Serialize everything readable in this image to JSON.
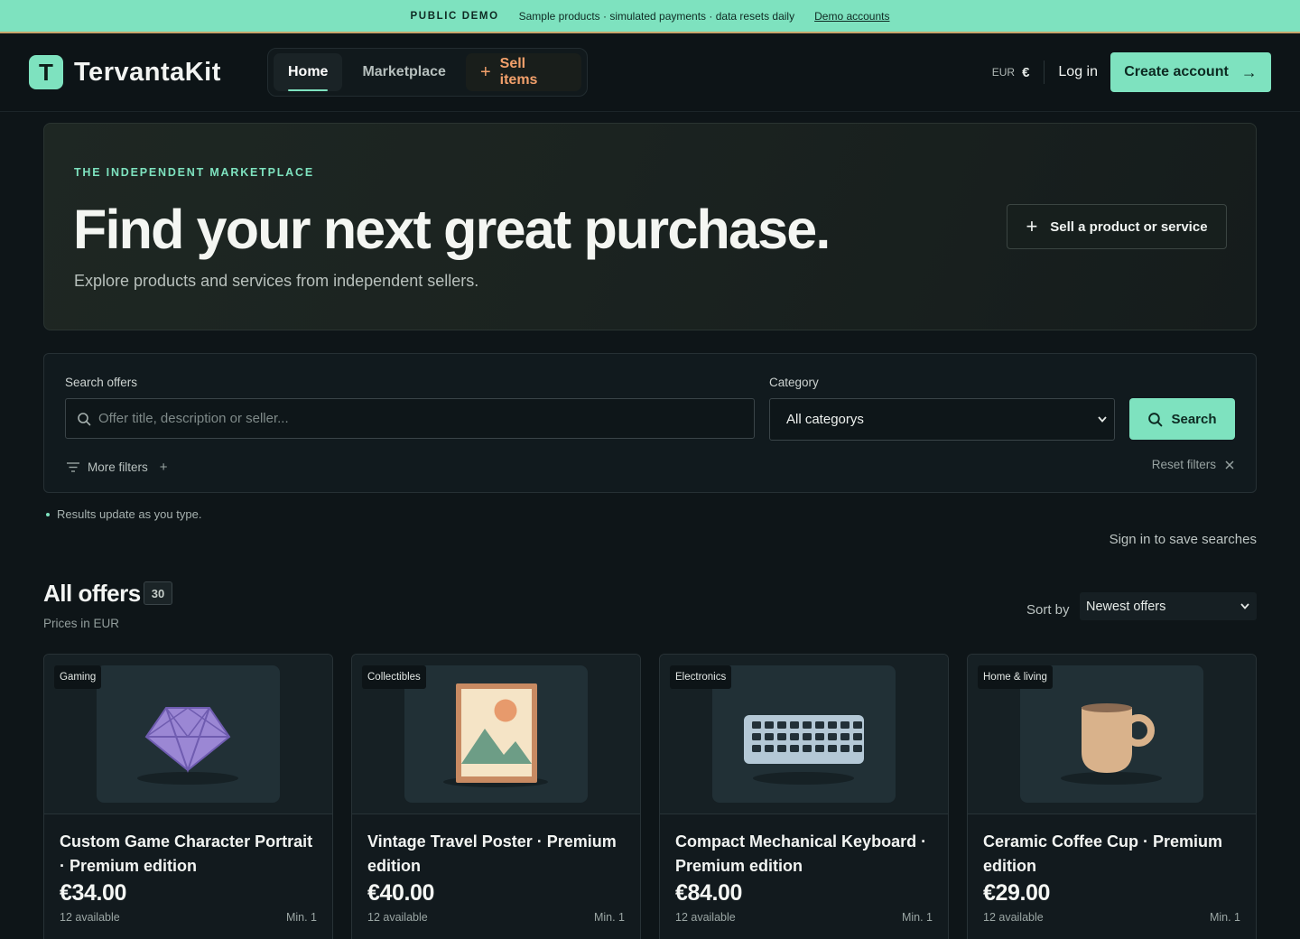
{
  "banner": {
    "tag": "PUBLIC DEMO",
    "text": "Sample products · simulated payments · data resets daily",
    "link": "Demo accounts"
  },
  "brand": {
    "mark": "T",
    "name": "TervantaKit",
    "accent": "#7ee2bf"
  },
  "nav": {
    "home": "Home",
    "marketplace": "Marketplace",
    "sell": "Sell items"
  },
  "header": {
    "currency_code": "EUR",
    "currency_symbol": "€",
    "login": "Log in",
    "create_account": "Create account"
  },
  "hero": {
    "eyebrow": "THE INDEPENDENT MARKETPLACE",
    "title": "Find your next great purchase.",
    "subtitle": "Explore products and services from independent sellers.",
    "sell_button": "Sell a product or service"
  },
  "search": {
    "label": "Search offers",
    "placeholder": "Offer title, description or seller...",
    "value": "",
    "category_label": "Category",
    "category_value": "All categorys",
    "button": "Search",
    "more_filters": "More filters",
    "reset_filters": "Reset filters"
  },
  "live_note": "Results update as you type.",
  "save_searches": "Sign in to save searches",
  "offers": {
    "title": "All offers",
    "count": "30",
    "prices_note": "Prices in EUR",
    "sort_label": "Sort by",
    "sort_value": "Newest offers"
  },
  "cards": [
    {
      "category": "Gaming",
      "title": "Custom Game Character Portrait · Premium edition",
      "price": "€34.00",
      "stock": "12 available",
      "min": "Min. 1",
      "icon": "gem-icon"
    },
    {
      "category": "Collectibles",
      "title": "Vintage Travel Poster · Premium edition",
      "price": "€40.00",
      "stock": "12 available",
      "min": "Min. 1",
      "icon": "framed-picture-icon"
    },
    {
      "category": "Electronics",
      "title": "Compact Mechanical Keyboard · Premium edition",
      "price": "€84.00",
      "stock": "12 available",
      "min": "Min. 1",
      "icon": "keyboard-icon"
    },
    {
      "category": "Home & living",
      "title": "Ceramic Coffee Cup · Premium edition",
      "price": "€29.00",
      "stock": "12 available",
      "min": "Min. 1",
      "icon": "mug-icon"
    }
  ]
}
